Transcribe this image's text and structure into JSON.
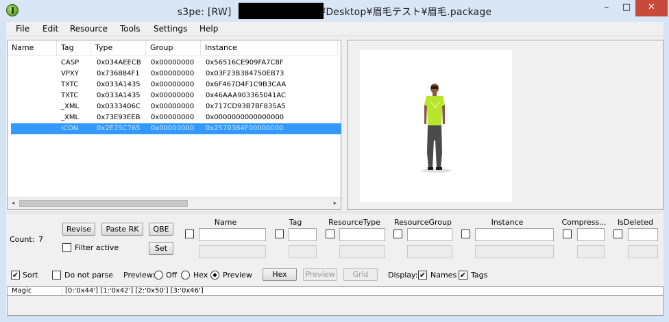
{
  "window": {
    "title_prefix": "s3pe: [RW] ",
    "title_suffix": "¥Desktop¥眉毛テスト¥眉毛.package",
    "minimize_glyph": "–",
    "maximize_glyph": "□",
    "close_glyph": "✕"
  },
  "menu": [
    "File",
    "Edit",
    "Resource",
    "Tools",
    "Settings",
    "Help"
  ],
  "list": {
    "columns": [
      "Name",
      "Tag",
      "Type",
      "Group",
      "Instance"
    ],
    "rows": [
      {
        "name": "",
        "tag": "CASP",
        "type": "0x034AEECB",
        "group": "0x00000000",
        "instance": "0x56516CE909FA7C8F"
      },
      {
        "name": "",
        "tag": "VPXY",
        "type": "0x736884F1",
        "group": "0x00000000",
        "instance": "0x03F23B384750EB73"
      },
      {
        "name": "",
        "tag": "TXTC",
        "type": "0x033A1435",
        "group": "0x00000000",
        "instance": "0x6F467D4F1C9B3CAA"
      },
      {
        "name": "",
        "tag": "TXTC",
        "type": "0x033A1435",
        "group": "0x00000000",
        "instance": "0x46AAA903365041AC"
      },
      {
        "name": "",
        "tag": "_XML",
        "type": "0x0333406C",
        "group": "0x00000000",
        "instance": "0x717CD93B7BF835A5"
      },
      {
        "name": "",
        "tag": "_XML",
        "type": "0x73E93EEB",
        "group": "0x00000000",
        "instance": "0x0000000000000000"
      },
      {
        "name": "",
        "tag": "ICON",
        "type": "0x2E75C765",
        "group": "0x00000000",
        "instance": "0x2570384F00000000"
      }
    ],
    "selected_index": 6,
    "scroll_left": "◂",
    "scroll_right": "▸"
  },
  "controls": {
    "count_label": "Count:",
    "count_value": "7",
    "revise": "Revise",
    "paste_rk": "Paste RK",
    "qbe": "QBE",
    "set": "Set",
    "filter_active": "Filter active"
  },
  "filter_columns": [
    "Name",
    "Tag",
    "ResourceType",
    "ResourceGroup",
    "Instance",
    "Compress...",
    "IsDeleted"
  ],
  "options": {
    "sort": "Sort",
    "sort_checked": true,
    "do_not_parse": "Do not parse",
    "preview_label": "Preview:",
    "off": "Off",
    "hex": "Hex",
    "preview": "Preview",
    "preview_mode": "Preview",
    "hex_button": "Hex",
    "preview_button": "Preview",
    "grid_button": "Grid",
    "display_label": "Display:",
    "names": "Names",
    "tags": "Tags",
    "check_mark": "✔"
  },
  "magic": {
    "label": "Magic",
    "value": "[0:'0x44'] [1:'0x42'] [2:'0x50'] [3:'0x46']"
  },
  "colors": {
    "selection": "#3399ff",
    "shirt": "#b7e52c",
    "pants": "#4a4a4a",
    "skin": "#8a5a3c",
    "close": "#c74a3a"
  },
  "icons": {
    "app": "s3pe-app-icon",
    "preview": "character-preview-figure"
  }
}
